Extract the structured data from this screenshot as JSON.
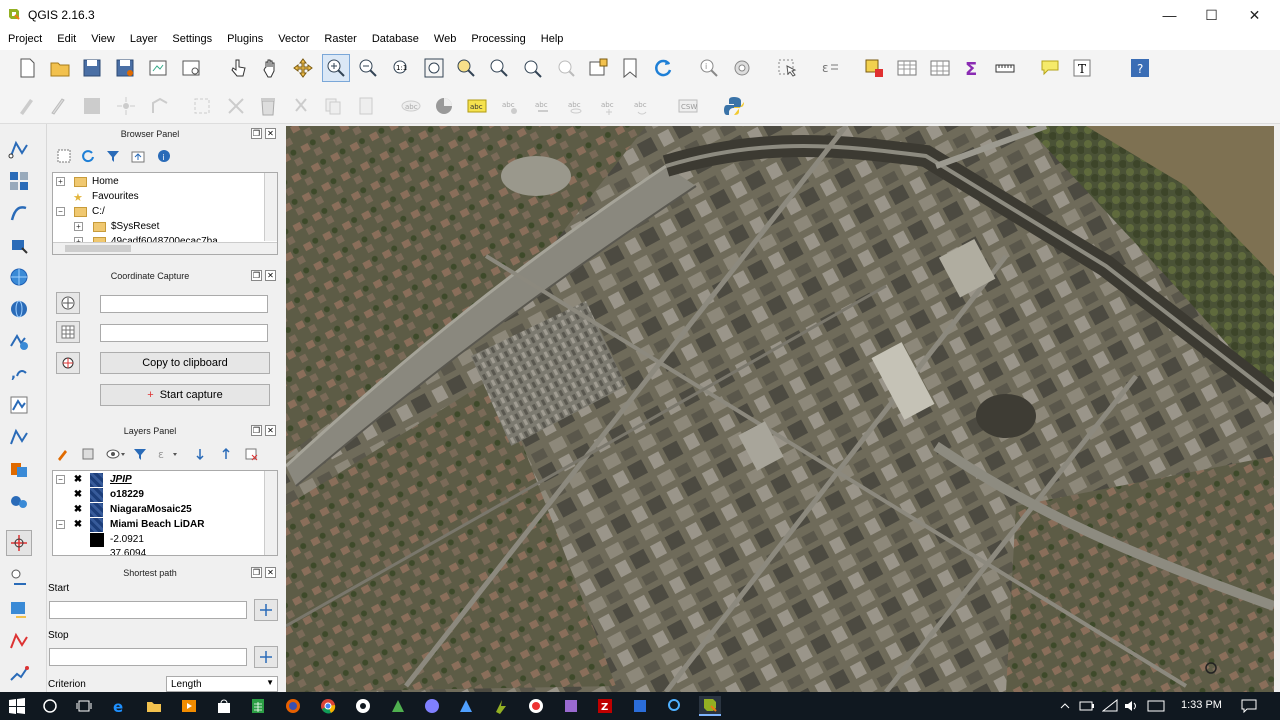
{
  "window": {
    "title": "QGIS 2.16.3",
    "minimize": "—",
    "maximize": "☐",
    "close": "✕"
  },
  "menu": [
    "Project",
    "Edit",
    "View",
    "Layer",
    "Settings",
    "Plugins",
    "Vector",
    "Raster",
    "Database",
    "Web",
    "Processing",
    "Help"
  ],
  "browser_panel": {
    "title": "Browser Panel",
    "items": [
      {
        "label": "Home",
        "expander": "+"
      },
      {
        "label": "Favourites",
        "expander": ""
      },
      {
        "label": "C:/",
        "expander": "−"
      },
      {
        "label": "$SysReset",
        "expander": "+"
      },
      {
        "label": "49cadf6048700ecac7ba",
        "expander": "+"
      }
    ]
  },
  "coordinate_capture": {
    "title": "Coordinate Capture",
    "copy_label": "Copy to clipboard",
    "start_label": "Start capture",
    "start_icon": "+"
  },
  "layers_panel": {
    "title": "Layers Panel",
    "layers": [
      {
        "name": "JPIP",
        "checked": "✖",
        "italic": true
      },
      {
        "name": "o18229",
        "checked": "✖"
      },
      {
        "name": "NiagaraMosaic25",
        "checked": "✖"
      },
      {
        "name": "Miami Beach LiDAR",
        "checked": "✖"
      }
    ],
    "legend_values": [
      "-2.0921",
      "37.6094"
    ]
  },
  "shortest_path": {
    "title": "Shortest path",
    "start_label": "Start",
    "stop_label": "Stop",
    "criterion_label": "Criterion",
    "criterion_value": "Length"
  },
  "taskbar": {
    "time": "1:33 PM"
  },
  "colors": {
    "accent": "#1e5fb4",
    "map_bg": "#6d6a58"
  }
}
